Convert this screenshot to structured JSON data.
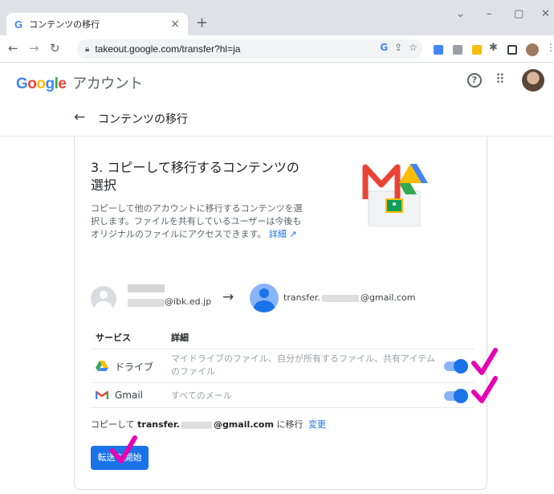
{
  "browser": {
    "tab_title": "コンテンツの移行",
    "tab_favicon": "G",
    "tab_close": "×",
    "new_tab": "+",
    "url": "takeout.google.com/transfer?hl=ja",
    "window_controls": [
      "chevron-down-icon",
      "minimize-icon",
      "maximize-icon",
      "close-icon"
    ]
  },
  "header": {
    "logo_brand": "Google",
    "logo_product": "アカウント",
    "help_icon_glyph": "?",
    "apps_icon_glyph": "⠿"
  },
  "subheader": {
    "back_glyph": "←",
    "title": "コンテンツの移行"
  },
  "step": {
    "title": "3. コピーして移行するコンテンツの選択",
    "description": "コピーして他のアカウントに移行するコンテンツを選択します。ファイルを共有しているユーザーは今後もオリジナルのファイルにアクセスできます。",
    "details_link": "詳細"
  },
  "accounts": {
    "source_email_suffix": "@ibk.ed.jp",
    "arrow": "→",
    "destination_prefix": "transfer.",
    "destination_suffix": "@gmail.com"
  },
  "services": {
    "header_service": "サービス",
    "header_detail": "詳細",
    "rows": [
      {
        "icon": "drive-icon",
        "name": "ドライブ",
        "detail": "マイドライブのファイル、自分が所有するファイル、共有アイテムのファイル",
        "enabled": true
      },
      {
        "icon": "gmail-icon",
        "name": "Gmail",
        "detail": "すべてのメール",
        "enabled": true
      }
    ]
  },
  "summary": {
    "prefix": "コピーして",
    "target_prefix": "transfer.",
    "target_suffix": "@gmail.com",
    "suffix": "に移行",
    "change_link": "変更"
  },
  "actions": {
    "start_label": "転送を開始"
  },
  "colors": {
    "accent": "#1a73e8",
    "annotation": "#e600b4"
  }
}
